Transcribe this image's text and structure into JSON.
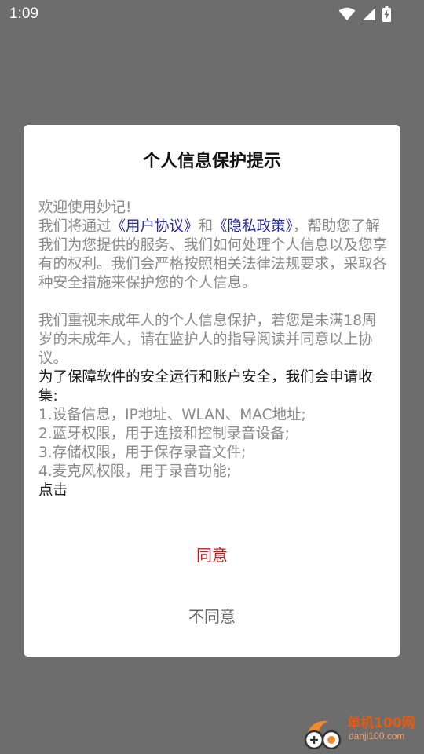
{
  "status_bar": {
    "time": "1:09",
    "icons": [
      "wifi-icon",
      "cell-signal-icon",
      "battery-charging-icon"
    ]
  },
  "dialog": {
    "title": "个人信息保护提示",
    "welcome": "欢迎使用妙记!",
    "p1_before": "我们将通过",
    "link_user_agreement": "《用户协议》",
    "p1_and": "和",
    "link_privacy_policy": "《隐私政策》",
    "p1_after": "，帮助您了解我们为您提供的服务、我们如何处理个人信息以及您享有的权利。我们会严格按照相关法律法规要求，采取各种安全措施来保护您的个人信息。",
    "p2": "我们重视未成年人的个人信息保护，若您是未满18周岁的未成年人，请在监护人的指导阅读并同意以上协议。",
    "p3": "为了保障软件的安全运行和账户安全，我们会申请收集:",
    "permissions": [
      "1.设备信息，IP地址、WLAN、MAC地址;",
      "2.蓝牙权限，用于连接和控制录音设备;",
      "3.存储权限，用于保存录音文件;",
      "4.麦克风权限，用于录音功能;"
    ],
    "click_text": "点击",
    "agree_label": "同意",
    "disagree_label": "不同意"
  },
  "watermark": {
    "title": "单机100网",
    "url": "danji100.com"
  },
  "colors": {
    "overlay": "#6d6d6d",
    "dialog_bg": "#ffffff",
    "link": "#2a2aa6",
    "agree": "#c8191f",
    "muted_text": "#8a8a8a",
    "dark_text": "#1a1a1a"
  }
}
